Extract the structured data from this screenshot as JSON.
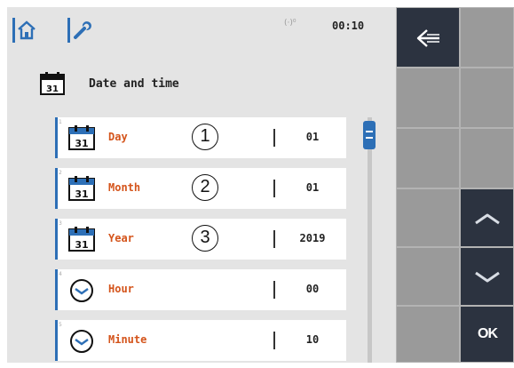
{
  "header": {
    "time": "00:10",
    "signal": "(·)⁰"
  },
  "page": {
    "title": "Date and time",
    "title_icon": "calendar-31-icon",
    "calendar_day": "31"
  },
  "rows": [
    {
      "index": "1",
      "icon": "calendar-icon",
      "label": "Day",
      "value": "01",
      "callout": "1"
    },
    {
      "index": "2",
      "icon": "calendar-icon",
      "label": "Month",
      "value": "01",
      "callout": "2"
    },
    {
      "index": "3",
      "icon": "calendar-icon",
      "label": "Year",
      "value": "2019",
      "callout": "3"
    },
    {
      "index": "4",
      "icon": "clock-icon",
      "label": "Hour",
      "value": "00"
    },
    {
      "index": "5",
      "icon": "clock-icon",
      "label": "Minute",
      "value": "10"
    }
  ],
  "side_panel": {
    "ok_label": "OK",
    "back_icon": "back-arrow-icon",
    "up_icon": "chevron-up-icon",
    "down_icon": "chevron-down-icon"
  },
  "colors": {
    "accent": "#2d6fb6",
    "label": "#d4541b",
    "panel": "#e4e4e4",
    "side_dark": "#2c3340"
  }
}
